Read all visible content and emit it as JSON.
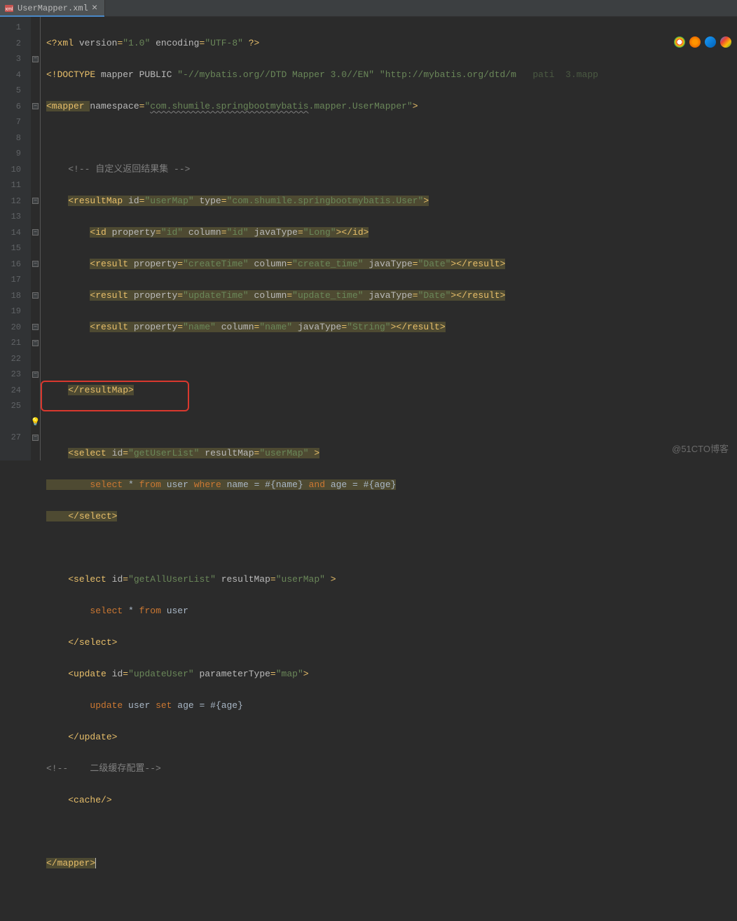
{
  "tab": {
    "label": "UserMapper.xml"
  },
  "lines": {
    "1": "<?xml version=\"1.0\" encoding=\"UTF-8\" ?>",
    "2a": "<!DOCTYPE mapper PUBLIC \"-//mybatis.org//DTD Mapper 3.0//EN\" \"http://mybatis.org/dtd/m",
    "2b": "pati=3.mapp",
    "3_tag": "mapper",
    "3_ns_attr": "namespace",
    "3_ns_val": "com.shumile.springbootmybatis.mapper.UserMapper",
    "5": "<!-- 自定义返回结果集 -->",
    "6_tag": "resultMap",
    "6_id_attr": "id",
    "6_id_val": "userMap",
    "6_type_attr": "type",
    "6_type_val": "com.shumile.springbootmybatis.User",
    "7_tag": "id",
    "7_prop_attr": "property",
    "7_prop_val": "id",
    "7_col_attr": "column",
    "7_col_val": "id",
    "7_jt_attr": "javaType",
    "7_jt_val": "Long",
    "8_tag": "result",
    "8_prop_val": "createTime",
    "8_col_val": "create_time",
    "8_jt_val": "Date",
    "9_prop_val": "updateTime",
    "9_col_val": "update_time",
    "9_jt_val": "Date",
    "10_prop_val": "name",
    "10_col_val": "name",
    "10_jt_val": "String",
    "12": "</resultMap>",
    "14_tag": "select",
    "14_id_val": "getUserList",
    "14_rm_attr": "resultMap",
    "14_rm_val": "userMap",
    "15_sql": "select * from user where name = #{name} and age = #{age}",
    "16": "</select>",
    "18_id_val": "getAllUserList",
    "19_sql": "select * from user",
    "20": "</select>",
    "21_tag": "update",
    "21_id_val": "updateUser",
    "21_pt_attr": "parameterType",
    "21_pt_val": "map",
    "22_sql": "update user set age = #{age}",
    "23": "</update>",
    "24": "<!--    二级缓存配置-->",
    "25": "<cache/>",
    "27": "</mapper>"
  },
  "watermark": "@51CTO博客"
}
